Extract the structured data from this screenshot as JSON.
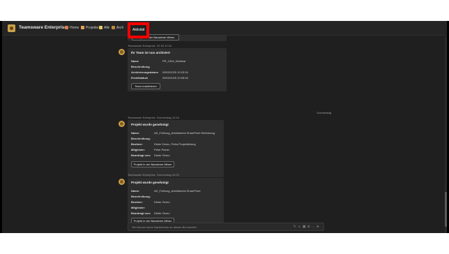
{
  "app": {
    "title": "Teamsware Enterprise"
  },
  "nav": {
    "home": "Home",
    "projekte": "Projekte",
    "alle": "Alle",
    "archiv": "Arch",
    "aktivitat": "Aktivität"
  },
  "top_partial_button": "Projekt in der Bausteine öffnen",
  "message1": {
    "sender": "Teamsware Enterprise",
    "time": "02.05 10:24",
    "title": "Ihr Team ist nun archiviert",
    "rows": [
      {
        "label": "Name",
        "value": "PR_1004_Webinar"
      },
      {
        "label": "Beschreibung",
        "value": ""
      },
      {
        "label": "Archivierungsdatum",
        "value": "09/02/2025 10:23:34"
      },
      {
        "label": "Erstelldatum",
        "value": "09/02/2025 10:05:26"
      }
    ],
    "button": "Team reaktivieren"
  },
  "day_separator": "Donnerstag",
  "message2": {
    "sender": "Teamsware Enterprise",
    "time": "Donnerstag 13:15",
    "title": "Projekt wurde genehmigt",
    "rows": [
      {
        "label": "Name:",
        "value": "AK_Freiburg_Arbeitskreis SharePoint Einführung"
      },
      {
        "label": "Beschreibung:",
        "value": ""
      },
      {
        "label": "Besitzer:",
        "value": "Dieter Demo, Petra Projektleitung"
      },
      {
        "label": "Mitglieder:",
        "value": "Peter Planer"
      },
      {
        "label": "Beantragt von:",
        "value": "Dieter Demo"
      }
    ],
    "button": "Projekt in der Bausteine öffnen"
  },
  "message3": {
    "sender": "Teamsware Enterprise",
    "time": "Donnerstag 13:29",
    "title": "Projekt wurde genehmigt",
    "rows": [
      {
        "label": "Name:",
        "value": "AK_Freiburg_Arbeitskreis SharePoint"
      },
      {
        "label": "Beschreibung:",
        "value": ""
      },
      {
        "label": "Besitzer:",
        "value": "Dieter Demo"
      },
      {
        "label": "Mitglieder:",
        "value": ""
      },
      {
        "label": "Beantragt von:",
        "value": "Dieter Demo"
      }
    ],
    "button": "Projekt in der Bausteine öffnen"
  },
  "compose": {
    "placeholder": "Sie können keine Nachrichten an diesen Bot senden",
    "icons": [
      "format-icon",
      "emoji-icon",
      "gif-icon",
      "attach-icon",
      "more-icon",
      "send-icon"
    ]
  },
  "colors": {
    "highlight": "#ff0000",
    "accent": "#c9a24a",
    "background": "#1f1f1f"
  }
}
